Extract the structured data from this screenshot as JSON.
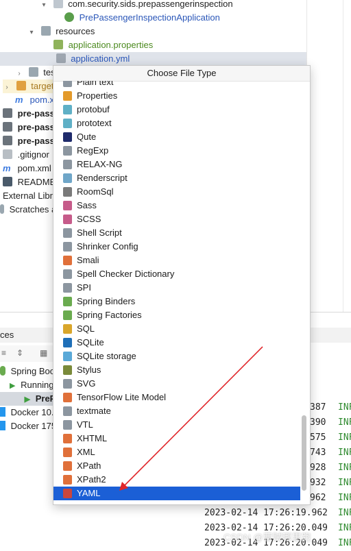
{
  "project_tree": {
    "package_name": "com.security.sids.prepassengerinspection",
    "app_class": "PrePassengerInspectionApplication",
    "resources_folder": "resources",
    "app_properties": "application.properties",
    "app_yml": "application.yml",
    "test_folder_partial": "tes",
    "target_folder_partial": "target",
    "pom_partial": "pom.x",
    "module1_partial": "pre-pass",
    "module2_partial": "pre-pass",
    "module3_partial": "pre-pass",
    "gitignore_partial": ".gitignor",
    "pom_xml_partial": "pom.xml",
    "readme_partial": "README",
    "external_libs_partial": "External Libr",
    "scratches_partial": "Scratches a"
  },
  "services": {
    "header_partial": "ces",
    "spring_boot_partial": "Spring Boo",
    "running_partial": "Running",
    "prep_partial": "PreP",
    "docker1_partial": "Docker 10.",
    "docker2_partial": "Docker 175"
  },
  "console": {
    "lines": [
      {
        "text": "387",
        "level": "INF"
      },
      {
        "text": "390",
        "level": "INF"
      },
      {
        "text": "575",
        "level": "INF"
      },
      {
        "text": "743",
        "level": "INF"
      },
      {
        "text": "928",
        "level": "INF"
      },
      {
        "text": "932",
        "level": "INF"
      },
      {
        "text": "962",
        "level": "INF"
      },
      {
        "text": "2023-02-14 17:26:19.962",
        "level": "INF"
      },
      {
        "text": "2023-02-14 17:26:20.049",
        "level": "INF"
      },
      {
        "text": "2023-02-14 17:26:20.049",
        "level": "INF"
      }
    ]
  },
  "popup": {
    "title": "Choose File Type",
    "items": [
      {
        "label": "Plain text",
        "icon": "text-file-icon",
        "color": "#8c96a0"
      },
      {
        "label": "Properties",
        "icon": "properties-icon",
        "color": "#e39a2b"
      },
      {
        "label": "protobuf",
        "icon": "protobuf-icon",
        "color": "#5fb0c6"
      },
      {
        "label": "prototext",
        "icon": "prototext-icon",
        "color": "#5fb0c6"
      },
      {
        "label": "Qute",
        "icon": "qute-icon",
        "color": "#1f2b6b"
      },
      {
        "label": "RegExp",
        "icon": "regexp-icon",
        "color": "#8c96a0"
      },
      {
        "label": "RELAX-NG",
        "icon": "relaxng-icon",
        "color": "#8c96a0"
      },
      {
        "label": "Renderscript",
        "icon": "renderscript-icon",
        "color": "#6fa6c8"
      },
      {
        "label": "RoomSql",
        "icon": "roomsql-icon",
        "color": "#7a7a7a"
      },
      {
        "label": "Sass",
        "icon": "sass-icon",
        "color": "#c65b8a"
      },
      {
        "label": "SCSS",
        "icon": "scss-icon",
        "color": "#c65b8a"
      },
      {
        "label": "Shell Script",
        "icon": "shell-script-icon",
        "color": "#8c96a0"
      },
      {
        "label": "Shrinker Config",
        "icon": "shrinker-config-icon",
        "color": "#8c96a0"
      },
      {
        "label": "Smali",
        "icon": "smali-icon",
        "color": "#e0703a"
      },
      {
        "label": "Spell Checker Dictionary",
        "icon": "dictionary-icon",
        "color": "#8c96a0"
      },
      {
        "label": "SPI",
        "icon": "spi-icon",
        "color": "#8c96a0"
      },
      {
        "label": "Spring Binders",
        "icon": "spring-binders-icon",
        "color": "#6aab4f"
      },
      {
        "label": "Spring Factories",
        "icon": "spring-factories-icon",
        "color": "#6aab4f"
      },
      {
        "label": "SQL",
        "icon": "sql-icon",
        "color": "#d9a62b"
      },
      {
        "label": "SQLite",
        "icon": "sqlite-icon",
        "color": "#1f6fb8"
      },
      {
        "label": "SQLite storage",
        "icon": "sqlite-storage-icon",
        "color": "#5aa9d8"
      },
      {
        "label": "Stylus",
        "icon": "stylus-icon",
        "color": "#7a8a3a"
      },
      {
        "label": "SVG",
        "icon": "svg-icon",
        "color": "#8c96a0"
      },
      {
        "label": "TensorFlow Lite Model",
        "icon": "tflite-icon",
        "color": "#e0703a"
      },
      {
        "label": "textmate",
        "icon": "textmate-icon",
        "color": "#8c96a0"
      },
      {
        "label": "VTL",
        "icon": "vtl-icon",
        "color": "#8c96a0"
      },
      {
        "label": "XHTML",
        "icon": "xhtml-icon",
        "color": "#e0703a"
      },
      {
        "label": "XML",
        "icon": "xml-icon",
        "color": "#e0703a"
      },
      {
        "label": "XPath",
        "icon": "xpath-icon",
        "color": "#e0703a"
      },
      {
        "label": "XPath2",
        "icon": "xpath2-icon",
        "color": "#e0703a"
      },
      {
        "label": "YAML",
        "icon": "yaml-icon",
        "color": "#c9463d",
        "selected": true
      }
    ]
  },
  "annotation": {
    "arrow_color": "#e0262a"
  },
  "watermark": "CSDN @曹贼哪里跑"
}
